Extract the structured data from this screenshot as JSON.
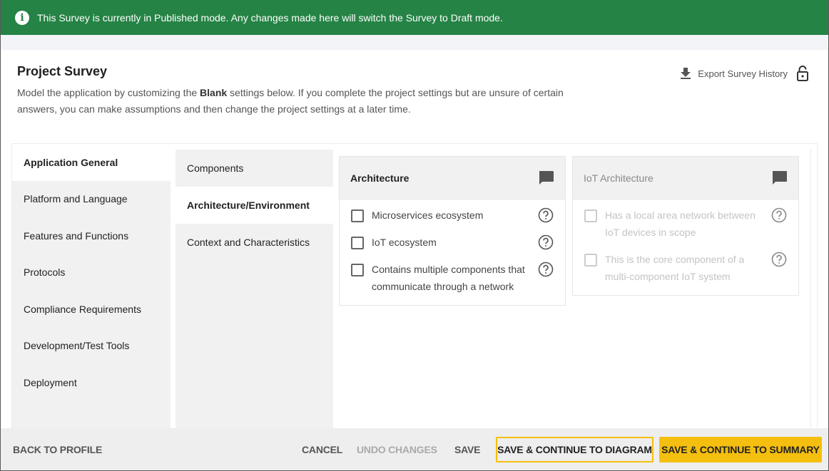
{
  "banner": {
    "icon": "info-icon",
    "message": "This Survey is currently in Published mode. Any changes made here will switch the Survey to Draft mode."
  },
  "header": {
    "title": "Project Survey",
    "description_prefix": "Model the application by customizing the ",
    "description_bold": "Blank",
    "description_suffix": " settings below. If you complete the project settings but are unsure of certain answers, you can make assumptions and then change the project settings at a later time.",
    "export_label": "Export Survey History",
    "export_icon": "download-icon",
    "lock_icon": "unlock-icon"
  },
  "nav_primary": {
    "active": "Application General",
    "items": [
      {
        "label": "Application General"
      },
      {
        "label": "Platform and Language"
      },
      {
        "label": "Features and Functions"
      },
      {
        "label": "Protocols"
      },
      {
        "label": "Compliance Requirements"
      },
      {
        "label": "Development/Test Tools"
      },
      {
        "label": "Deployment"
      }
    ]
  },
  "nav_secondary": {
    "active": "Architecture/Environment",
    "items": [
      {
        "label": "Components"
      },
      {
        "label": "Architecture/Environment"
      },
      {
        "label": "Context and Characteristics"
      }
    ]
  },
  "cards": [
    {
      "title": "Architecture",
      "icon": "comment-icon",
      "disabled": false,
      "options": [
        {
          "label": "Microservices ecosystem",
          "checked": false
        },
        {
          "label": "IoT ecosystem",
          "checked": false
        },
        {
          "label": "Contains multiple components that communicate through a network",
          "checked": false
        }
      ]
    },
    {
      "title": "IoT Architecture",
      "icon": "comment-icon",
      "disabled": true,
      "options": [
        {
          "label": "Has a local area network between IoT devices in scope",
          "checked": false
        },
        {
          "label": "This is the core component of a multi-component IoT system",
          "checked": false
        }
      ]
    }
  ],
  "footer": {
    "back": "BACK TO PROFILE",
    "cancel": "CANCEL",
    "undo": "UNDO CHANGES",
    "save": "SAVE",
    "save_diagram": "SAVE & CONTINUE TO DIAGRAM",
    "save_summary": "SAVE & CONTINUE TO SUMMARY"
  },
  "colors": {
    "banner": "#258345",
    "primary_action": "#f5bf0f"
  }
}
